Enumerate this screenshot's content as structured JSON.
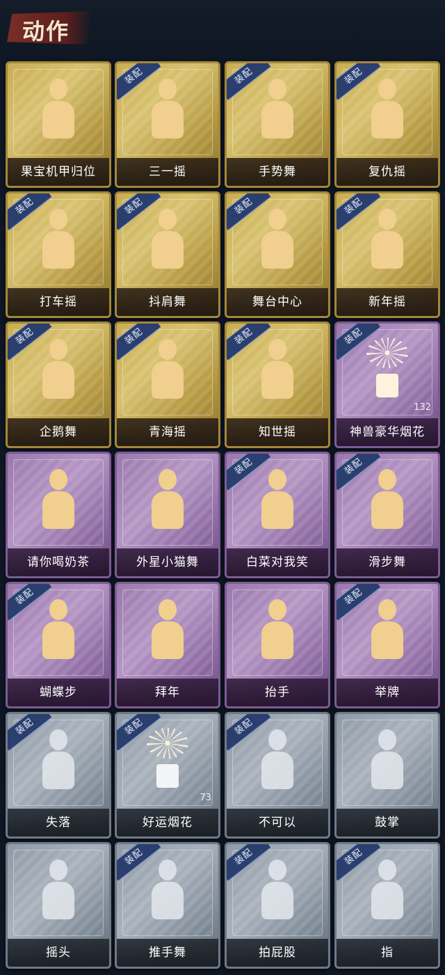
{
  "header": {
    "title": "动作"
  },
  "equip_label": "装配",
  "cards": [
    {
      "label": "果宝机甲归位",
      "tier": "gold",
      "equipped": false,
      "kind": "pose"
    },
    {
      "label": "三一摇",
      "tier": "gold",
      "equipped": true,
      "kind": "pose"
    },
    {
      "label": "手势舞",
      "tier": "gold",
      "equipped": true,
      "kind": "pose"
    },
    {
      "label": "复仇摇",
      "tier": "gold",
      "equipped": true,
      "kind": "pose"
    },
    {
      "label": "打车摇",
      "tier": "gold",
      "equipped": true,
      "kind": "pose"
    },
    {
      "label": "抖肩舞",
      "tier": "gold",
      "equipped": true,
      "kind": "pose"
    },
    {
      "label": "舞台中心",
      "tier": "gold",
      "equipped": true,
      "kind": "pose"
    },
    {
      "label": "新年摇",
      "tier": "gold",
      "equipped": true,
      "kind": "pose"
    },
    {
      "label": "企鹅舞",
      "tier": "gold",
      "equipped": true,
      "kind": "pose"
    },
    {
      "label": "青海摇",
      "tier": "gold",
      "equipped": true,
      "kind": "pose"
    },
    {
      "label": "知世摇",
      "tier": "gold",
      "equipped": true,
      "kind": "pose"
    },
    {
      "label": "神兽豪华烟花",
      "tier": "purple",
      "equipped": true,
      "kind": "firework",
      "count": "132"
    },
    {
      "label": "请你喝奶茶",
      "tier": "purple",
      "equipped": false,
      "kind": "pose"
    },
    {
      "label": "外星小猫舞",
      "tier": "purple",
      "equipped": false,
      "kind": "pose"
    },
    {
      "label": "白菜对我笑",
      "tier": "purple",
      "equipped": true,
      "kind": "pose"
    },
    {
      "label": "滑步舞",
      "tier": "purple",
      "equipped": true,
      "kind": "pose"
    },
    {
      "label": "蝴蝶步",
      "tier": "purple",
      "equipped": true,
      "kind": "pose"
    },
    {
      "label": "拜年",
      "tier": "purple",
      "equipped": false,
      "kind": "pose"
    },
    {
      "label": "抬手",
      "tier": "purple",
      "equipped": false,
      "kind": "pose"
    },
    {
      "label": "举牌",
      "tier": "purple",
      "equipped": true,
      "kind": "pose"
    },
    {
      "label": "失落",
      "tier": "grey",
      "equipped": true,
      "kind": "pose"
    },
    {
      "label": "好运烟花",
      "tier": "grey",
      "equipped": true,
      "kind": "firework",
      "count": "73"
    },
    {
      "label": "不可以",
      "tier": "grey",
      "equipped": true,
      "kind": "pose"
    },
    {
      "label": "鼓掌",
      "tier": "grey",
      "equipped": false,
      "kind": "pose"
    },
    {
      "label": "摇头",
      "tier": "grey",
      "equipped": false,
      "kind": "pose"
    },
    {
      "label": "推手舞",
      "tier": "grey",
      "equipped": true,
      "kind": "pose"
    },
    {
      "label": "拍屁股",
      "tier": "grey",
      "equipped": true,
      "kind": "pose"
    },
    {
      "label": "指",
      "tier": "grey",
      "equipped": true,
      "kind": "pose"
    }
  ]
}
